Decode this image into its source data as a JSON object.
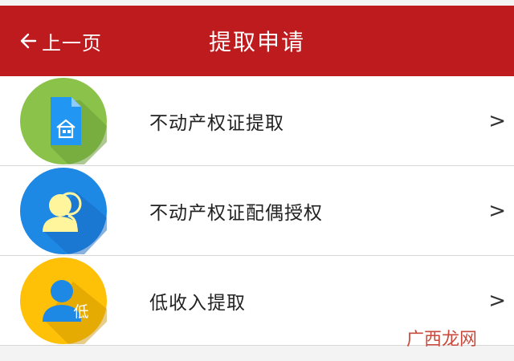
{
  "header": {
    "back_label": "上一页",
    "title": "提取申请",
    "color": "#bd1b1e"
  },
  "items": [
    {
      "label": "不动产权证提取",
      "icon": "house-document-icon",
      "icon_color": "#8bc34a",
      "chevron": ">"
    },
    {
      "label": "不动产权证配偶授权",
      "icon": "people-icon",
      "icon_color": "#1e88e5",
      "chevron": ">"
    },
    {
      "label": "低收入提取",
      "icon": "person-low-income-icon",
      "icon_color": "#ffc107",
      "chevron": ">"
    }
  ],
  "watermark": "广西龙网"
}
